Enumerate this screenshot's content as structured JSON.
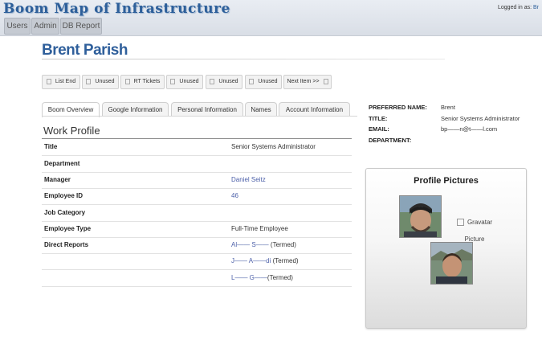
{
  "header": {
    "app_title": "Boom Map of Infrastructure",
    "logged_in_label": "Logged in as:",
    "logged_in_user": "Br",
    "nav": [
      "Users",
      "Admin",
      "DB Report"
    ]
  },
  "person": {
    "name": "Brent Parish"
  },
  "pager": {
    "buttons": [
      "List End",
      "Unused",
      "RT Tickets",
      "Unused",
      "Unused",
      "Unused",
      "Next Item >>"
    ]
  },
  "tabs": [
    "Boom Overview",
    "Google Information",
    "Personal Information",
    "Names",
    "Account Information"
  ],
  "work_profile": {
    "title": "Work Profile",
    "rows": [
      {
        "label": "Title",
        "value": "Senior Systems Administrator"
      },
      {
        "label": "Department",
        "value": ""
      },
      {
        "label": "Manager",
        "value": "Daniel Seitz"
      },
      {
        "label": "Employee ID",
        "value": "46"
      },
      {
        "label": "Job Category",
        "value": ""
      },
      {
        "label": "Employee Type",
        "value": "Full-Time Employee"
      },
      {
        "label": "Direct Reports",
        "value": "Al—— S——",
        "suffix": "(Termed)"
      },
      {
        "label": "",
        "value": "J—— A——di",
        "suffix": "(Termed)"
      },
      {
        "label": "",
        "value": "L—— G——",
        "suffix": "(Termed)"
      }
    ]
  },
  "info": {
    "preferred_name_label": "PREFERRED NAME:",
    "preferred_name": "Brent",
    "title_label": "TITLE:",
    "title": "Senior Systems Administrator",
    "email_label": "EMAIL:",
    "email": "bp——n@t——l.com",
    "department_label": "DEPARTMENT:",
    "department": ""
  },
  "profile_pictures": {
    "title": "Profile Pictures",
    "gravatar_line1": "Gravatar",
    "gravatar_line2": "Picture"
  },
  "colors": {
    "accent": "#2f5f9b",
    "link": "#4b5fa8"
  }
}
